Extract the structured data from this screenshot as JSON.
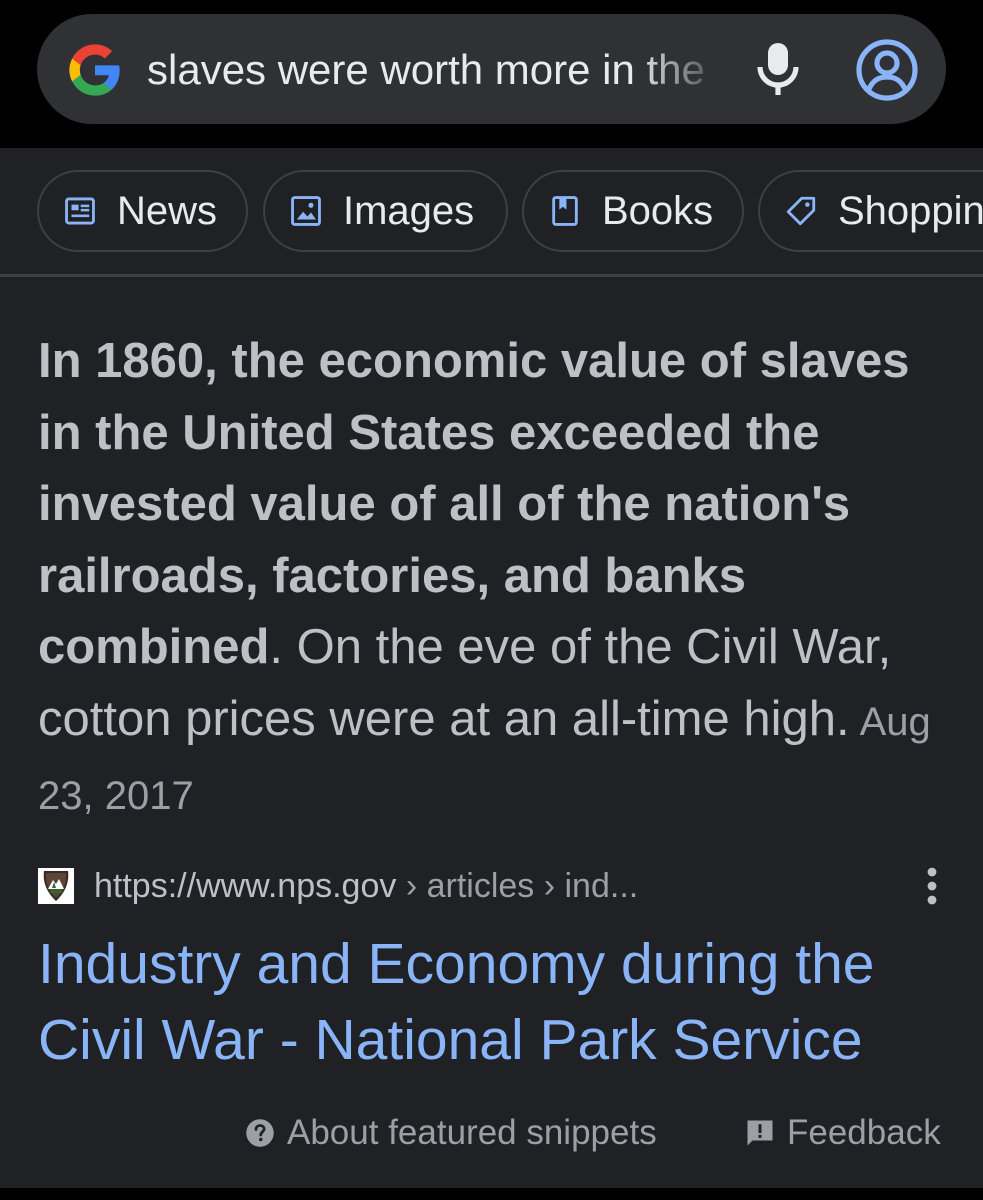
{
  "search": {
    "query": "slaves were worth more in the",
    "icons": {
      "logo": "google-logo",
      "voice": "mic-icon",
      "account": "account-circle-icon"
    }
  },
  "chips": [
    {
      "label": "News",
      "icon": "news-icon"
    },
    {
      "label": "Images",
      "icon": "image-icon"
    },
    {
      "label": "Books",
      "icon": "book-icon"
    },
    {
      "label": "Shopping",
      "icon": "tag-icon"
    }
  ],
  "snippet": {
    "bold_text": "In 1860, the economic value of slaves in the United States exceeded the invested value of all of the nation's railroads, factories, and banks combined",
    "rest_text": ". On the eve of the Civil War, cotton prices were at an all-time high.",
    "date": "Aug 23, 2017"
  },
  "source": {
    "url": "https://www.nps.gov",
    "path": " › articles › ind...",
    "favicon": "nps-arrowhead-icon"
  },
  "result": {
    "title": "Industry and Economy during the Civil War - National Park Service"
  },
  "footer": {
    "about": "About featured snippets",
    "feedback": "Feedback"
  },
  "colors": {
    "background": "#202124",
    "search_bg": "#303134",
    "link": "#8ab4f8",
    "text": "#bdc1c6",
    "muted": "#9aa0a6"
  }
}
